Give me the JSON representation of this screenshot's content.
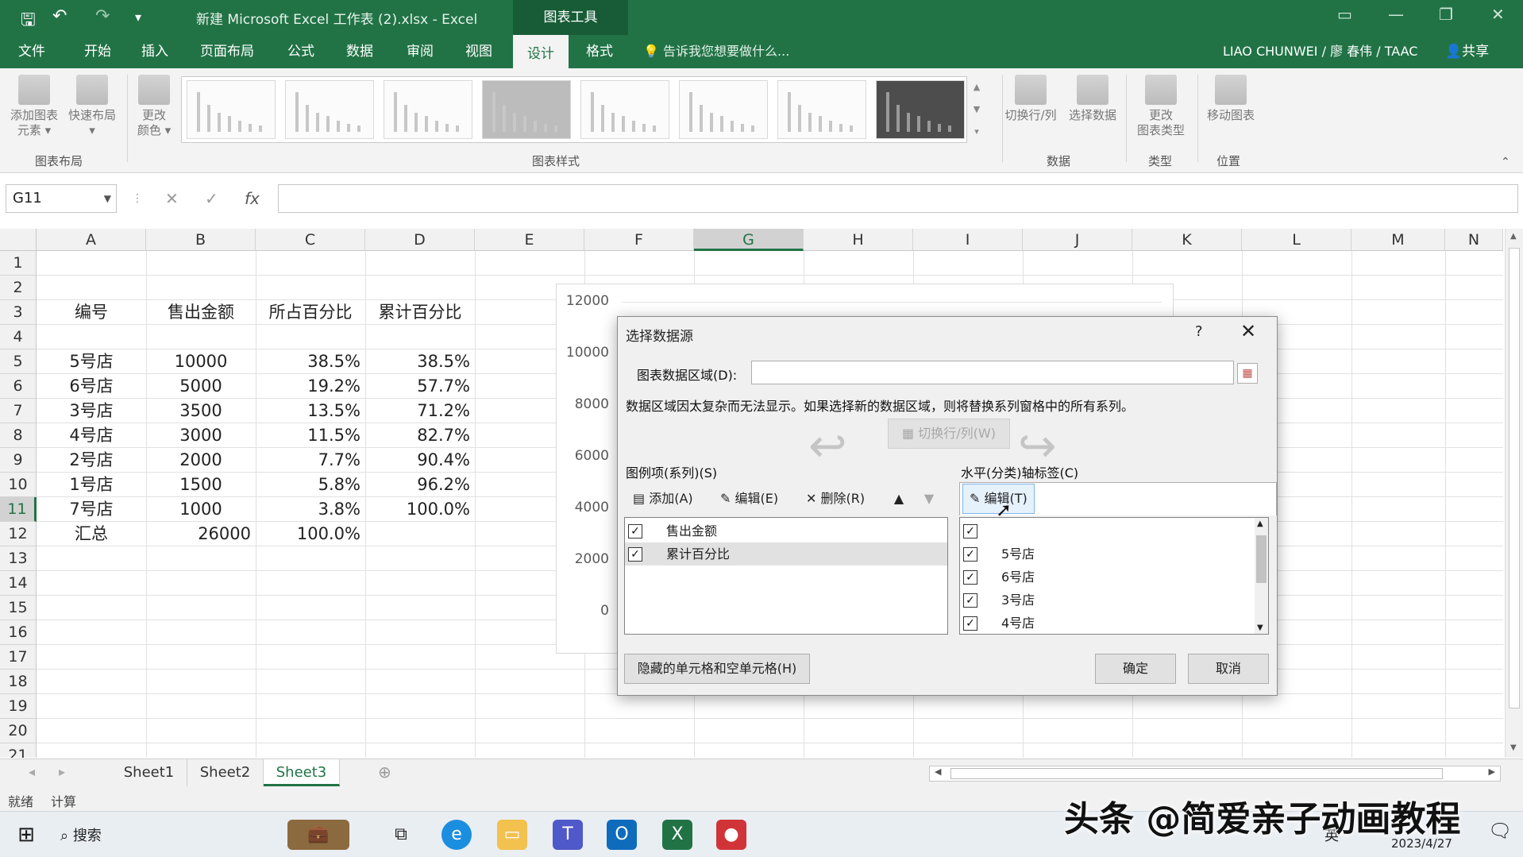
{
  "title_bar": {
    "file_title": "新建 Microsoft Excel 工作表 (2).xlsx - Excel",
    "context_tool": "图表工具"
  },
  "tabs": [
    "文件",
    "开始",
    "插入",
    "页面布局",
    "公式",
    "数据",
    "审阅",
    "视图",
    "设计",
    "格式"
  ],
  "active_tab": "设计",
  "tell_me": "告诉我您想要做什么...",
  "user": "LIAO CHUNWEI / 廖 春伟 / TAAC",
  "share": "共享",
  "ribbon": {
    "add_element": [
      "添加图表",
      "元素 ▾"
    ],
    "quick_layout": [
      "快速布局",
      "▾"
    ],
    "change_colors": [
      "更改",
      "颜色 ▾"
    ],
    "group_layout": "图表布局",
    "group_styles": "图表样式",
    "switch_row_col": [
      "切换行/列"
    ],
    "select_data": [
      "选择数据"
    ],
    "group_data": "数据",
    "change_type": [
      "更改",
      "图表类型"
    ],
    "group_type": "类型",
    "move_chart": [
      "移动图表"
    ],
    "group_position": "位置"
  },
  "formula_bar": {
    "name_box": "G11",
    "fx": "fx",
    "cancel": "✕",
    "enter": "✓"
  },
  "columns": [
    "A",
    "B",
    "C",
    "D",
    "E",
    "F",
    "G",
    "H",
    "I",
    "J",
    "K",
    "L",
    "M",
    "N"
  ],
  "selected_column": "G",
  "rows": [
    "1",
    "2",
    "3",
    "4",
    "5",
    "6",
    "7",
    "8",
    "9",
    "10",
    "11",
    "12",
    "13",
    "14",
    "15",
    "16",
    "17",
    "18",
    "19",
    "20",
    "21"
  ],
  "selected_row": "11",
  "table": {
    "headers": [
      "编号",
      "售出金额",
      "所占百分比",
      "累计百分比"
    ],
    "rows": [
      [
        "5号店",
        "10000",
        "38.5%",
        "38.5%"
      ],
      [
        "6号店",
        "5000",
        "19.2%",
        "57.7%"
      ],
      [
        "3号店",
        "3500",
        "13.5%",
        "71.2%"
      ],
      [
        "4号店",
        "3000",
        "11.5%",
        "82.7%"
      ],
      [
        "2号店",
        "2000",
        "7.7%",
        "90.4%"
      ],
      [
        "1号店",
        "1500",
        "5.8%",
        "96.2%"
      ],
      [
        "7号店",
        "1000",
        "3.8%",
        "100.0%"
      ]
    ],
    "total": [
      "汇总",
      "26000",
      "100.0%"
    ]
  },
  "chart_axis": [
    "12000",
    "10000",
    "8000",
    "6000",
    "4000",
    "2000",
    "0"
  ],
  "dialog": {
    "title": "选择数据源",
    "help": "?",
    "close": "✕",
    "range_label": "图表数据区域(D):",
    "range_value": "",
    "note": "数据区域因太复杂而无法显示。如果选择新的数据区域，则将替换系列窗格中的所有系列。",
    "switch_label": "切换行/列(W)",
    "legend_label": "图例项(系列)(S)",
    "add": "添加(A)",
    "edit": "编辑(E)",
    "remove": "删除(R)",
    "series": [
      "售出金额",
      "累计百分比"
    ],
    "axis_label": "水平(分类)轴标签(C)",
    "axis_edit": "编辑(T)",
    "categories": [
      "",
      "5号店",
      "6号店",
      "3号店",
      "4号店"
    ],
    "hidden_cells": "隐藏的单元格和空单元格(H)",
    "ok": "确定",
    "cancel": "取消"
  },
  "sheets": [
    "Sheet1",
    "Sheet2",
    "Sheet3"
  ],
  "active_sheet": "Sheet3",
  "status": {
    "ready": "就绪",
    "calc": "计算"
  },
  "taskbar": {
    "search": "搜索",
    "ime": "英",
    "date": "2023/4/27"
  },
  "watermark": "头条 @简爱亲子动画教程",
  "colors": {
    "excel_green": "#217346",
    "ribbon_bg": "#f3f3f3",
    "dialog_bg": "#f0f0f0"
  }
}
